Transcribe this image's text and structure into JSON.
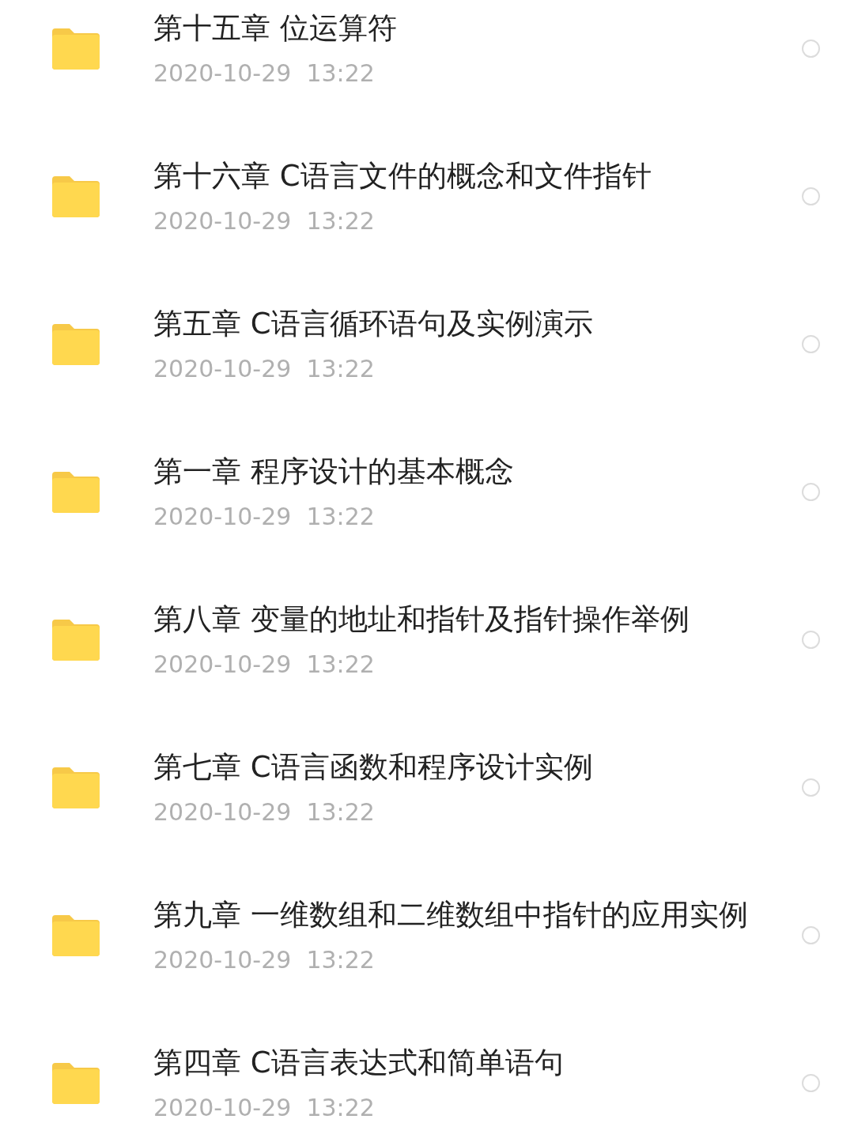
{
  "files": [
    {
      "name": "第十五章 位运算符",
      "modified": "2020-10-29  13:22",
      "selected": false
    },
    {
      "name": "第十六章 C语言文件的概念和文件指针",
      "modified": "2020-10-29  13:22",
      "selected": false
    },
    {
      "name": "第五章 C语言循环语句及实例演示",
      "modified": "2020-10-29  13:22",
      "selected": false
    },
    {
      "name": "第一章 程序设计的基本概念",
      "modified": "2020-10-29  13:22",
      "selected": false
    },
    {
      "name": "第八章 变量的地址和指针及指针操作举例",
      "modified": "2020-10-29  13:22",
      "selected": false
    },
    {
      "name": "第七章 C语言函数和程序设计实例",
      "modified": "2020-10-29  13:22",
      "selected": false
    },
    {
      "name": "第九章 一维数组和二维数组中指针的应用实例",
      "modified": "2020-10-29  13:22",
      "selected": false
    },
    {
      "name": "第四章 C语言表达式和简单语句",
      "modified": "2020-10-29  13:22",
      "selected": false
    }
  ]
}
